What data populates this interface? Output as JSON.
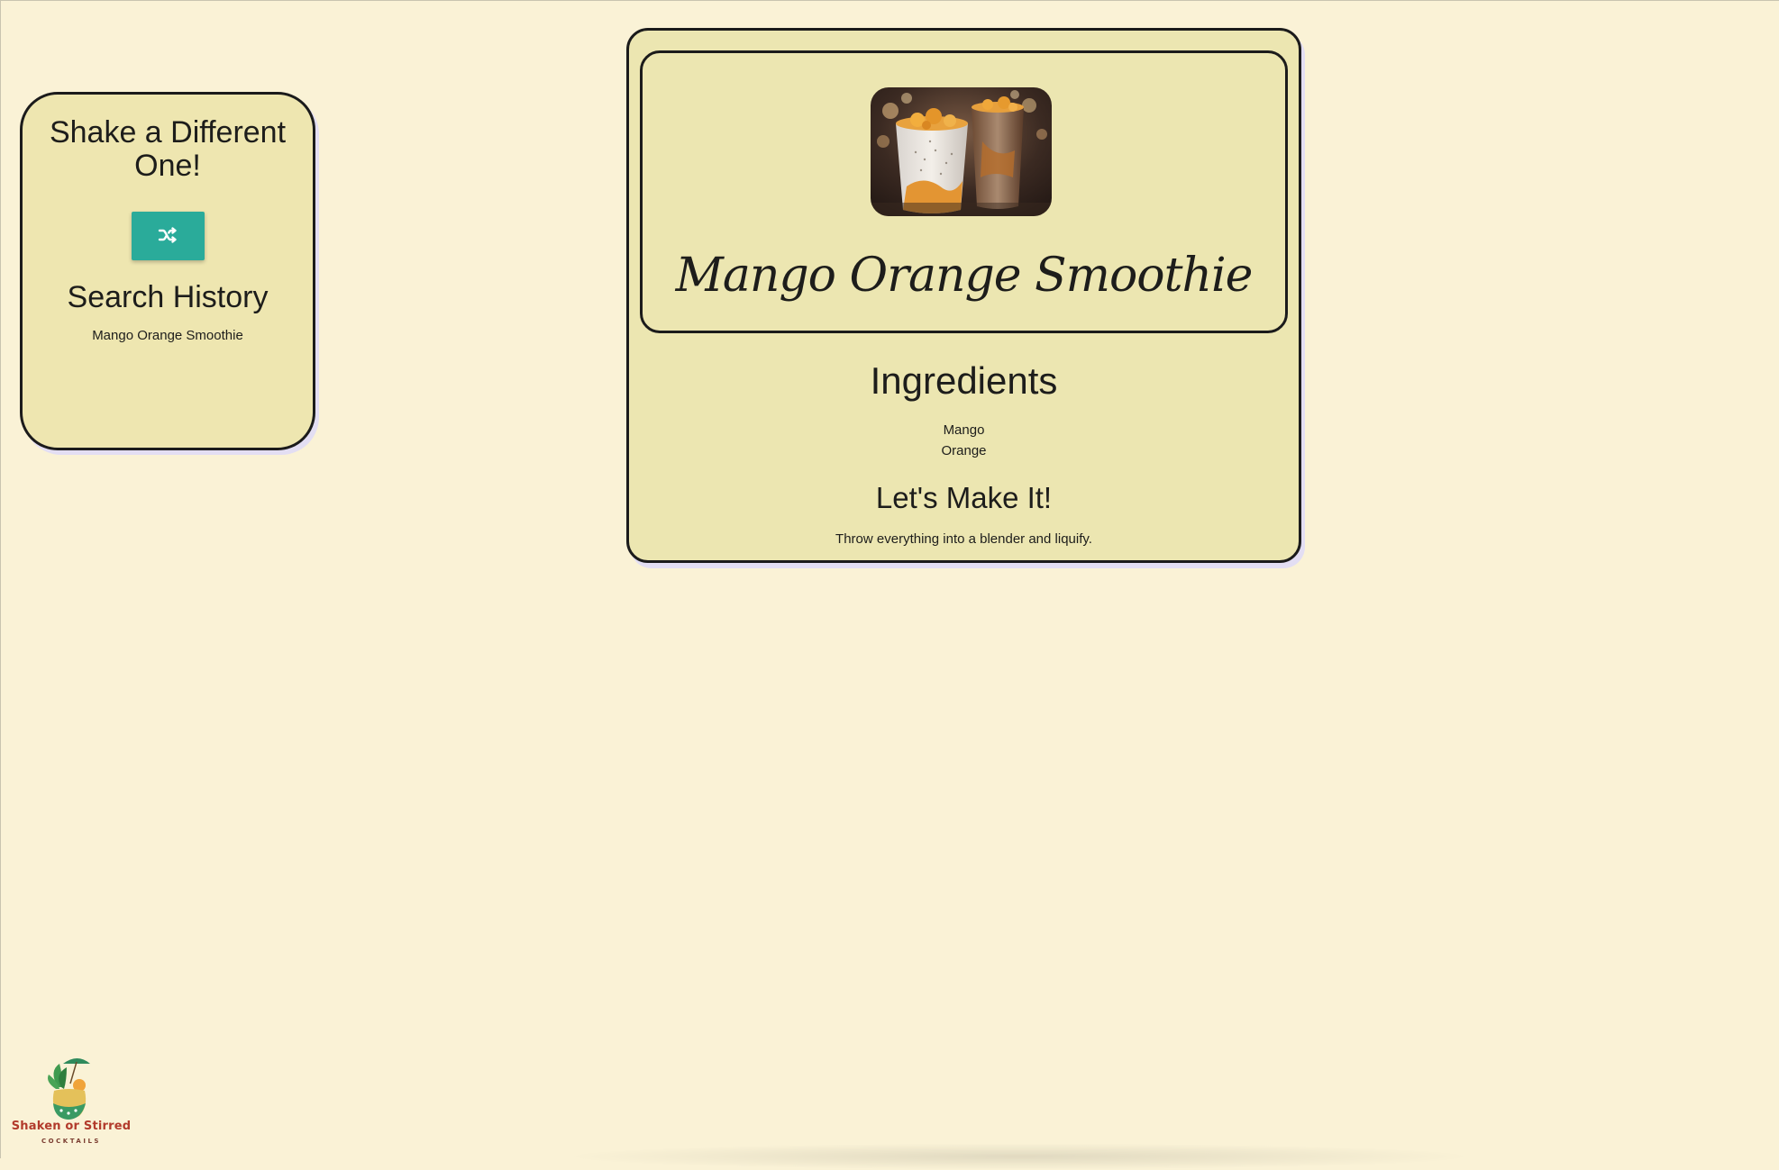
{
  "sidebar": {
    "shake_title": "Shake a Different One!",
    "history_title": "Search History",
    "history_items": [
      "Mango Orange Smoothie"
    ]
  },
  "recipe": {
    "image_alt": "Mango Orange Smoothie",
    "name": "Mango Orange Smoothie",
    "ingredients_title": "Ingredients",
    "ingredients": [
      "Mango",
      "Orange"
    ],
    "instructions_title": "Let's Make It!",
    "instructions": "Throw everything into a blender and liquify."
  },
  "icons": {
    "shuffle": "shuffle-icon"
  },
  "logo": {
    "name": "Shaken or Stirred",
    "sub": "COCKTAILS"
  },
  "colors": {
    "page_bg": "#faf2d6",
    "card_bg": "#ece6b1",
    "accent_button": "#2aab9a",
    "logo_text": "#b23a2b"
  }
}
